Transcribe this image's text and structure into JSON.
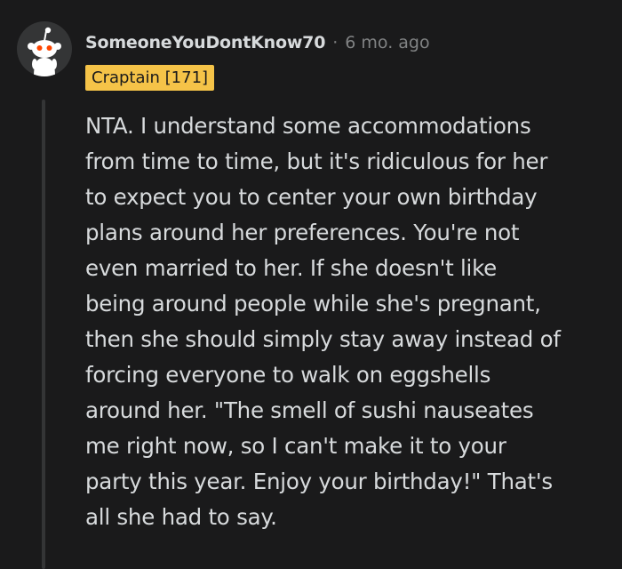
{
  "comment": {
    "username": "SomeoneYouDontKnow70",
    "separator": "·",
    "timestamp": "6 mo. ago",
    "flair": "Craptain [171]",
    "avatar_icon": "reddit-snoo-icon",
    "body_lines": "NTA. I understand some accommodations\nfrom time to time, but it's ridiculous for her\nto expect you to center your own birthday\nplans around her preferences. You're not\neven married to her. If she doesn't like\nbeing around people while she's pregnant,\nthen she should simply stay away instead of\nforcing everyone to walk on eggshells\naround her. \"The smell of sushi nauseates\nme right now, so I can't make it to your\nparty this year. Enjoy your birthday!\" That's\nall she had to say."
  },
  "colors": {
    "background": "#1a1a1b",
    "text": "#d7dadc",
    "muted": "#818384",
    "flair_bg": "#f5c348",
    "thread_line": "#343536",
    "snoo_eye": "#ff4500"
  }
}
